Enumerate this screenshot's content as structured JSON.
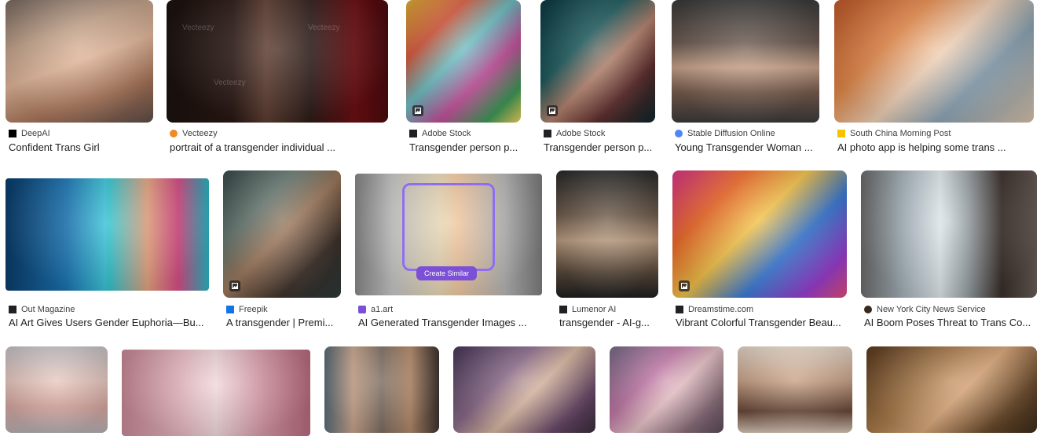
{
  "colors": {
    "page_bg": "#ffffff",
    "text": "#202124",
    "source_text": "#3c4043",
    "overlay_accent": "#7b4fd6"
  },
  "results": [
    {
      "source": "DeepAI",
      "title": "Confident Trans Girl",
      "favicon": "deepai-icon",
      "fav_color": "#000000",
      "badge": false,
      "bg": "linear-gradient(160deg,#7a6b63,#c6a58c 30%,#e2b79b 50%,#a9755a 75%,#5d4d47)"
    },
    {
      "source": "Vecteezy",
      "title": "portrait of a transgender individual ...",
      "favicon": "vecteezy-icon",
      "fav_color": "#f08a24",
      "badge": false,
      "bg": "linear-gradient(90deg,#1a120f,#2a1713 30%,#5a3a2e 45%,#2b1a16 65%,#6e0f13 85%,#4a0a0d)"
    },
    {
      "source": "Adobe Stock",
      "title": "Transgender person p...",
      "favicon": "adobe-stock-icon",
      "fav_color": "#202124",
      "badge": true,
      "bg": "linear-gradient(135deg,#e2b23a,#d75a3f 25%,#6fc0c3 45%,#c34e9a 65%,#3f9a58 85%,#f2d35a)"
    },
    {
      "source": "Adobe Stock",
      "title": "Transgender person p...",
      "favicon": "adobe-stock-icon",
      "fav_color": "#202124",
      "badge": true,
      "bg": "linear-gradient(135deg,#0d3b43,#1d5a5c 35%,#b3826e 55%,#5b2b2a 75%,#0b262b)"
    },
    {
      "source": "Stable Diffusion Online",
      "title": "Young Transgender Woman ...",
      "favicon": "stable-diffusion-icon",
      "fav_color": "#4f86f7",
      "badge": false,
      "bg": "linear-gradient(180deg,#3b3b3b,#6b5a50 35%,#c9a38b 55%,#7a5e4f 75%,#3a3a3a)"
    },
    {
      "source": "South China Morning Post",
      "title": "AI photo app is helping some trans ...",
      "favicon": "scmp-icon",
      "fav_color": "#f5c400",
      "badge": false,
      "bg": "linear-gradient(135deg,#c25a2b,#e58a4b 30%,#f0d2b8 50%,#8aa3b4 70%,#d8c2aa)"
    },
    {
      "source": "Out Magazine",
      "title": "AI Art Gives Users Gender Euphoria—Bu...",
      "favicon": "out-magazine-icon",
      "fav_color": "#202124",
      "badge": false,
      "bg": "linear-gradient(90deg,#0b3d6b,#1b75b5 30%,#38c1d6 49%,#30c2cc 51%,#e8a37f 70%,#d9508a 85%,#2ab8c4)"
    },
    {
      "source": "Freepik",
      "title": "A transgender | Premi...",
      "favicon": "freepik-icon",
      "fav_color": "#1273eb",
      "badge": true,
      "bg": "linear-gradient(135deg,#3a4d4c,#6a7a74 30%,#9e7a5e 50%,#3b2f28 75%,#2b3a3a)"
    },
    {
      "source": "a1.art",
      "title": "AI Generated Transgender Images ...",
      "favicon": "a1-art-icon",
      "fav_color": "#7b4fd6",
      "badge": false,
      "bg": "linear-gradient(90deg,#8a8a8a,#c9c9c9 20%,#e8d7b5 45%,#f1c8a0 55%,#b9b9b9 80%,#7d7d7d)"
    },
    {
      "source": "Lumenor AI",
      "title": "transgender - AI-g...",
      "favicon": "lumenor-icon",
      "fav_color": "#202124",
      "badge": false,
      "bg": "linear-gradient(180deg,#2b2b2b,#6c5a4a 35%,#b89a7f 55%,#5a4a3c 80%,#1e1e1e)"
    },
    {
      "source": "Dreamstime.com",
      "title": "Vibrant Colorful Transgender Beau...",
      "favicon": "dreamstime-icon",
      "fav_color": "#202124",
      "badge": true,
      "bg": "linear-gradient(135deg,#e0398d,#f06a2a 25%,#f3c24a 45%,#3a7bd5 65%,#9b3fd1 85%,#e14b7a)"
    },
    {
      "source": "New York City News Service",
      "title": "AI Boom Poses Threat to Trans Co...",
      "favicon": "nyc-news-icon",
      "fav_color": "#3a2a1e",
      "badge": false,
      "bg": "linear-gradient(90deg,#6c6c6c,#a9b7bf 25%,#dfe6ea 45%,#9aa3a8 60%,#3a2f2a 80%,#6a5e57)"
    },
    {
      "source": "",
      "title": "",
      "favicon": "",
      "fav_color": "",
      "badge": false,
      "bg": "linear-gradient(180deg,#c9c4c8,#e8c9c0 40%,#d9a9a2 70%,#b7b0b4)"
    },
    {
      "source": "",
      "title": "",
      "favicon": "",
      "fav_color": "",
      "badge": false,
      "bg": "linear-gradient(90deg,#c98a97,#e6b5bf 30%,#f0d7da 50%,#d99aa9 75%,#b86a7d)"
    },
    {
      "source": "",
      "title": "",
      "favicon": "",
      "fav_color": "",
      "badge": false,
      "bg": "linear-gradient(90deg,#5a6e7a,#c9a58d 25%,#7a6a5f 50%,#b48a6a 75%,#3e3430)"
    },
    {
      "source": "",
      "title": "",
      "favicon": "",
      "fav_color": "",
      "badge": false,
      "bg": "linear-gradient(135deg,#4a3a5a,#8a6a8a 35%,#d9b8a2 55%,#6a4a6a 80%,#3a2a3a)"
    },
    {
      "source": "",
      "title": "",
      "favicon": "",
      "fav_color": "",
      "badge": false,
      "bg": "linear-gradient(135deg,#7a6e8a,#c27aa8 35%,#e8c3c8 55%,#8a6e7a 80%,#5a4a5a)"
    },
    {
      "source": "",
      "title": "",
      "favicon": "",
      "fav_color": "",
      "badge": false,
      "bg": "linear-gradient(180deg,#e8d9cc,#c9a286 40%,#6a4a3a 75%,#d9c7b8)"
    },
    {
      "source": "",
      "title": "",
      "favicon": "",
      "fav_color": "",
      "badge": false,
      "bg": "linear-gradient(135deg,#5a3a1e,#a87a4a 35%,#d9a77a 55%,#6a4a2a 80%,#3a2a1a)"
    }
  ],
  "overlay": {
    "create_similar_label": "Create Similar"
  }
}
